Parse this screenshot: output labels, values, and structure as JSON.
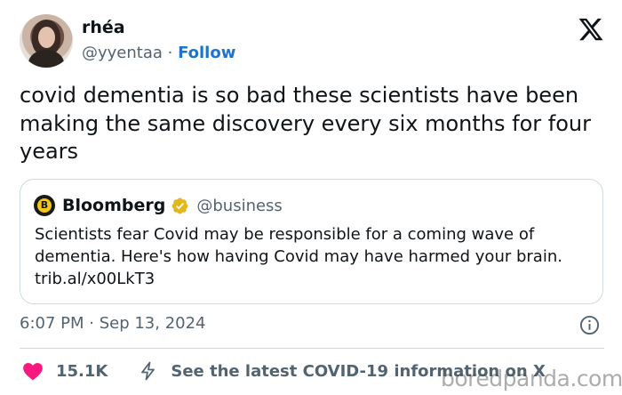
{
  "author": {
    "name": "rhéa",
    "handle": "@yyentaa",
    "separator": " · ",
    "follow_label": "Follow"
  },
  "header": {
    "logo_icon": "x-logo-icon"
  },
  "tweet": {
    "text": "covid dementia is so bad these scientists have been making the same discovery every six months for four years"
  },
  "quote": {
    "logo_letter": "B",
    "name": "Bloomberg",
    "verified_icon": "gold-verified-badge-icon",
    "handle": "@business",
    "text": "Scientists fear Covid may be responsible for a coming wave of dementia. Here's how having Covid may have harmed your brain. trib.al/x00LkT3"
  },
  "meta": {
    "timestamp": "6:07 PM · Sep 13, 2024",
    "info_icon": "info-icon"
  },
  "actions": {
    "likes": "15.1K",
    "like_icon": "heart-icon",
    "covid_icon": "lightning-icon",
    "covid_link": "See the latest COVID-19 information on X"
  },
  "watermark": "boredpanda.com",
  "colors": {
    "follow": "#1d74c9",
    "heart": "#f91880",
    "verified": "#e2b719",
    "secondary_text": "#536471",
    "border": "#cfd9de"
  }
}
